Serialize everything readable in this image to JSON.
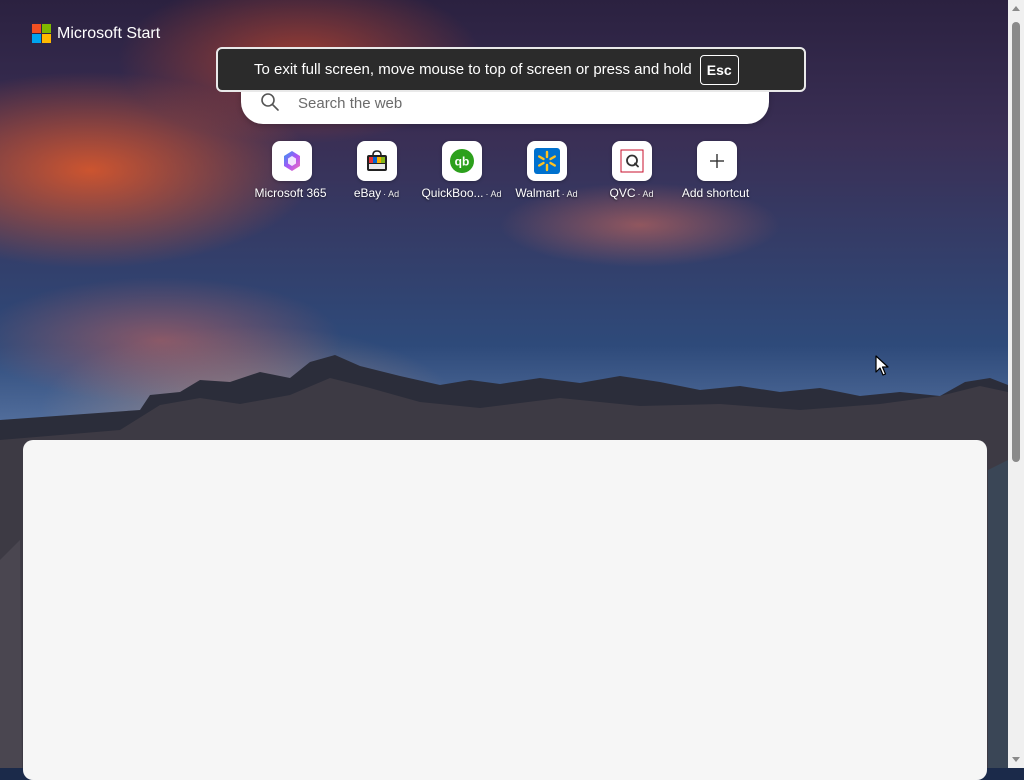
{
  "app": {
    "brand": "Microsoft Start"
  },
  "search": {
    "placeholder": "Search the web",
    "icon": "search-icon"
  },
  "fullscreen_toast": {
    "message": "To exit full screen, move mouse to top of screen or press and hold",
    "key": "Esc"
  },
  "shortcuts": [
    {
      "label": "Microsoft 365",
      "ad": "",
      "icon": "microsoft-365-icon"
    },
    {
      "label": "eBay",
      "ad": "· Ad",
      "icon": "ebay-icon"
    },
    {
      "label": "QuickBoo...",
      "ad": "· Ad",
      "icon": "quickbooks-icon"
    },
    {
      "label": "Walmart",
      "ad": "· Ad",
      "icon": "walmart-icon"
    },
    {
      "label": "QVC",
      "ad": "· Ad",
      "icon": "qvc-icon"
    },
    {
      "label": "Add shortcut",
      "ad": "",
      "icon": "plus-icon"
    }
  ],
  "colors": {
    "microsoft_red": "#f25022",
    "microsoft_green": "#7fba00",
    "microsoft_blue": "#00a4ef",
    "microsoft_yellow": "#ffb900",
    "quickbooks_green": "#2ca01c",
    "walmart_blue": "#0071ce",
    "walmart_yellow": "#ffc220",
    "panel_background": "#f6f6f6"
  }
}
